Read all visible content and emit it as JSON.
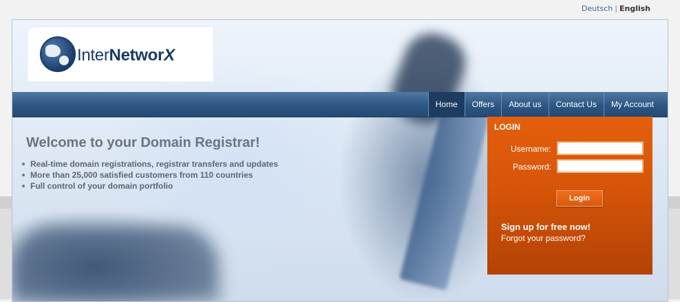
{
  "lang": {
    "german": "Deutsch",
    "separator": "|",
    "english": "English"
  },
  "logo": {
    "part1": "Inter",
    "part2": "Networ",
    "part3": "X"
  },
  "nav": [
    {
      "label": "Home",
      "active": true
    },
    {
      "label": "Offers"
    },
    {
      "label": "About us"
    },
    {
      "label": "Contact Us"
    },
    {
      "label": "My Account"
    }
  ],
  "welcome": {
    "title": "Welcome to your Domain Registrar!",
    "bullets": [
      "Real-time domain registrations, registrar transfers and updates",
      "More than 25,000 satisfied customers from 110 countries",
      "Full control of your domain portfolio"
    ]
  },
  "login": {
    "title": "LOGIN",
    "username_label": "Username:",
    "password_label": "Password:",
    "username_value": "",
    "password_value": "",
    "button": "Login",
    "signup": "Sign up for free now!",
    "forgot": "Forgot your password?"
  },
  "colors": {
    "accent": "#d65509",
    "nav": "#2d5682",
    "brand": "#1a3a66"
  }
}
